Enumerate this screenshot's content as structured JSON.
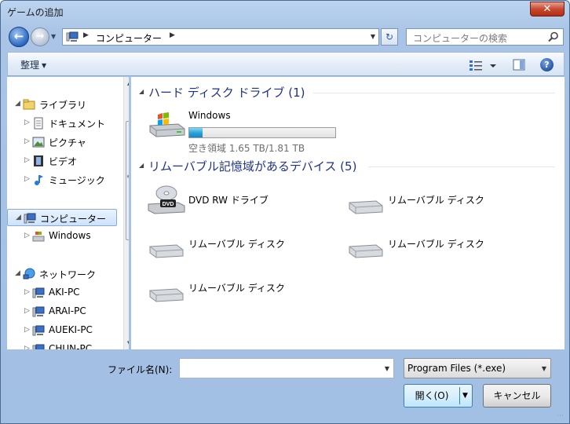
{
  "window": {
    "title": "ゲームの追加",
    "close_label": "✕"
  },
  "nav": {
    "address_path": "コンピューター",
    "search_placeholder": "コンピューターの検索"
  },
  "toolbar": {
    "organize_label": "整理"
  },
  "sidebar": {
    "items": [
      {
        "label": "ライブラリ",
        "icon": "libraries-icon",
        "level": 0,
        "expander": "◢"
      },
      {
        "label": "ドキュメント",
        "icon": "documents-icon",
        "level": 1,
        "expander": "▷"
      },
      {
        "label": "ピクチャ",
        "icon": "pictures-icon",
        "level": 1,
        "expander": "▷"
      },
      {
        "label": "ビデオ",
        "icon": "videos-icon",
        "level": 1,
        "expander": "▷"
      },
      {
        "label": "ミュージック",
        "icon": "music-icon",
        "level": 1,
        "expander": "▷"
      },
      {
        "label": "コンピューター",
        "icon": "computer-icon",
        "level": 0,
        "expander": "◢",
        "selected": true
      },
      {
        "label": "Windows",
        "icon": "drive-icon",
        "level": 1,
        "expander": "▷"
      },
      {
        "label": "ネットワーク",
        "icon": "network-icon",
        "level": 0,
        "expander": "◢"
      },
      {
        "label": "AKI-PC",
        "icon": "pc-icon",
        "level": 1,
        "expander": "▷"
      },
      {
        "label": "ARAI-PC",
        "icon": "pc-icon",
        "level": 1,
        "expander": "▷"
      },
      {
        "label": "AUEKI-PC",
        "icon": "pc-icon",
        "level": 1,
        "expander": "▷"
      },
      {
        "label": "CHUN-PC",
        "icon": "pc-icon",
        "level": 1,
        "expander": "▷"
      }
    ]
  },
  "content": {
    "groups": [
      {
        "title": "ハード ディスク ドライブ (1)",
        "drives": [
          {
            "label": "Windows",
            "icon": "windows-drive-icon",
            "free_text": "空き領域 1.65 TB/1.81 TB",
            "used_fraction": 0.09
          }
        ]
      },
      {
        "title": "リムーバブル記憶域があるデバイス (5)",
        "drives": [
          {
            "label": "DVD RW ドライブ",
            "icon": "dvd-drive-icon"
          },
          {
            "label": "リムーバブル ディスク",
            "icon": "removable-disk-icon"
          },
          {
            "label": "リムーバブル ディスク",
            "icon": "removable-disk-icon"
          },
          {
            "label": "リムーバブル ディスク",
            "icon": "removable-disk-icon"
          },
          {
            "label": "リムーバブル ディスク",
            "icon": "removable-disk-icon"
          }
        ]
      }
    ]
  },
  "footer": {
    "filename_label": "ファイル名(N):",
    "filename_value": "",
    "filetype_value": "Program Files (*.exe)",
    "open_label": "開く(O)",
    "cancel_label": "キャンセル"
  }
}
